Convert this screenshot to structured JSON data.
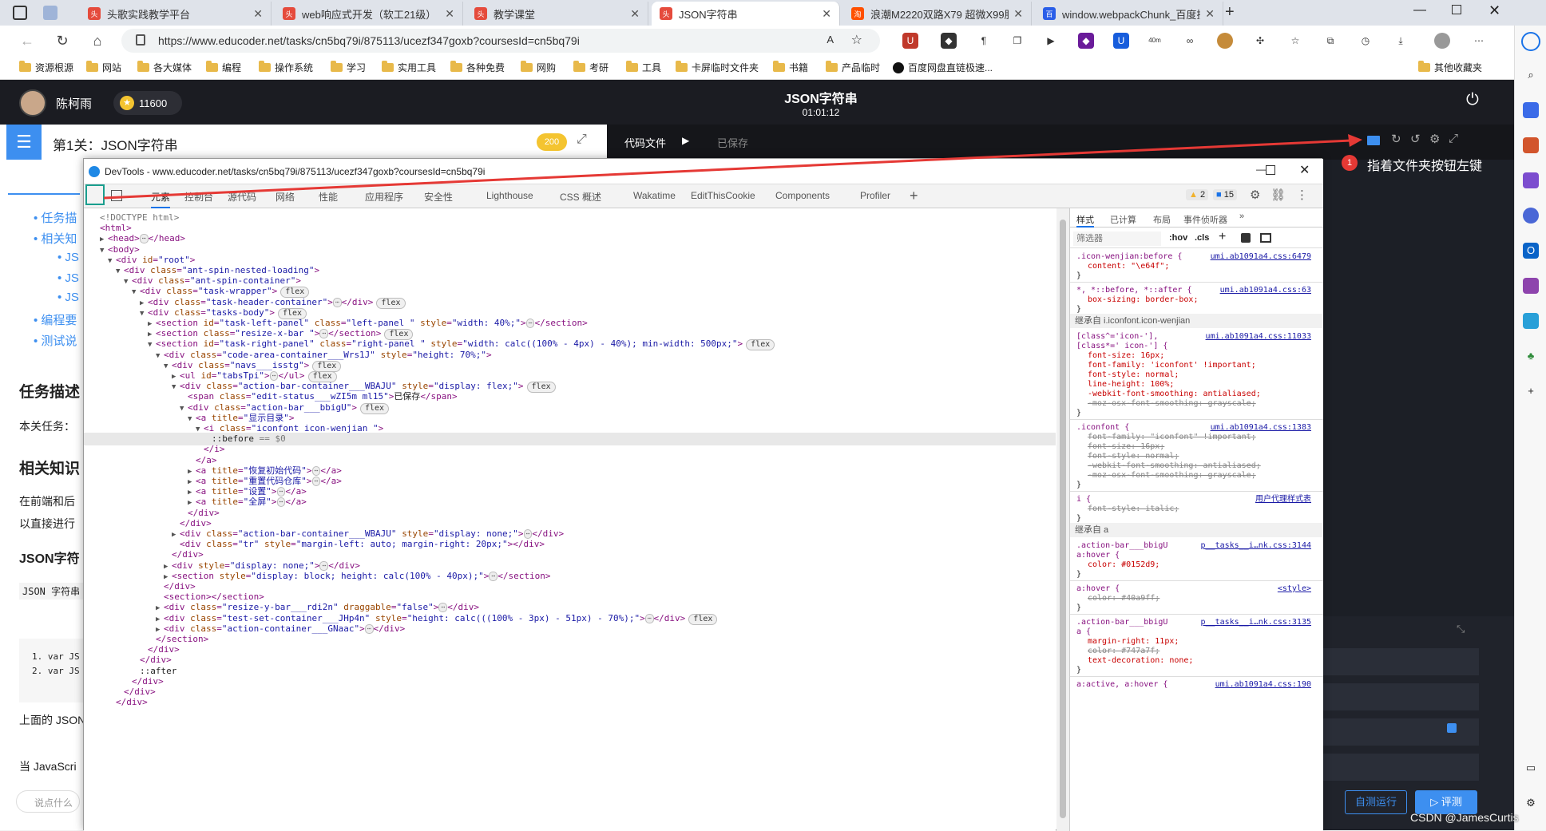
{
  "browser": {
    "tabs": [
      {
        "title": "头歌实践教学平台",
        "fav": "头",
        "color": "#e54b3c"
      },
      {
        "title": "web响应式开发（软工21级）",
        "fav": "头",
        "color": "#e54b3c"
      },
      {
        "title": "教学课堂",
        "fav": "头",
        "color": "#e54b3c"
      },
      {
        "title": "JSON字符串",
        "fav": "头",
        "color": "#e54b3c"
      },
      {
        "title": "浪潮M2220双路X79 超微X99服务器",
        "fav": "淘",
        "color": "#ff5000"
      },
      {
        "title": "window.webpackChunk_百度搜索",
        "fav": "百",
        "color": "#2a5ee8"
      }
    ],
    "url": "https://www.educoder.net/tasks/cn5bq79i/875113/ucezf347goxb?coursesId=cn5bq79i",
    "ext_badge": "40m",
    "bookmarks": [
      "资源根源",
      "网站",
      "各大媒体",
      "编程",
      "操作系统",
      "学习",
      "实用工具",
      "各种免费",
      "网购",
      "考研",
      "工具",
      "卡屏临时文件夹",
      "书籍",
      "产品临时",
      "百度网盘直链极速...",
      "其他收藏夹"
    ]
  },
  "app": {
    "user": "陈柯雨",
    "coins": "11600",
    "title": "JSON字符串",
    "timer": "01:01:12",
    "level_title": "第1关：JSON字符串",
    "level_score": "200",
    "code_tab": "代码文件",
    "saved": "已保存",
    "left_items": [
      "任务描",
      "相关知",
      "JS",
      "JS",
      "JS",
      "编程要",
      "测试说"
    ],
    "left_texts": [
      "任务描述",
      "本关任务：",
      "相关知识",
      "在前端和后",
      "以直接进行",
      "JSON字符",
      "JSON 字符串",
      "1. var JS",
      "2. var JS",
      "上面的 JSON",
      "当 JavaScri",
      "说点什么"
    ],
    "annotation_num": "1",
    "annotation": "指着文件夹按钮左键",
    "btn_run": "自测运行",
    "btn_eval": "评测",
    "watermark": "CSDN @JamesCurtis"
  },
  "devtools": {
    "title": "DevTools - www.educoder.net/tasks/cn5bq79i/875113/ucezf347goxb?coursesId=cn5bq79i",
    "tabs": [
      "元素",
      "控制台",
      "源代码",
      "网络",
      "性能",
      "应用程序",
      "安全性",
      "Lighthouse",
      "CSS 概述",
      "Wakatime",
      "EditThisCookie",
      "Components",
      "Profiler"
    ],
    "warn_count": "2",
    "info_count": "15",
    "style_tabs": [
      "样式",
      "已计算",
      "布局",
      "事件侦听器"
    ],
    "filter_placeholder": "筛选器",
    "hov": ":hov",
    "cls": ".cls"
  }
}
